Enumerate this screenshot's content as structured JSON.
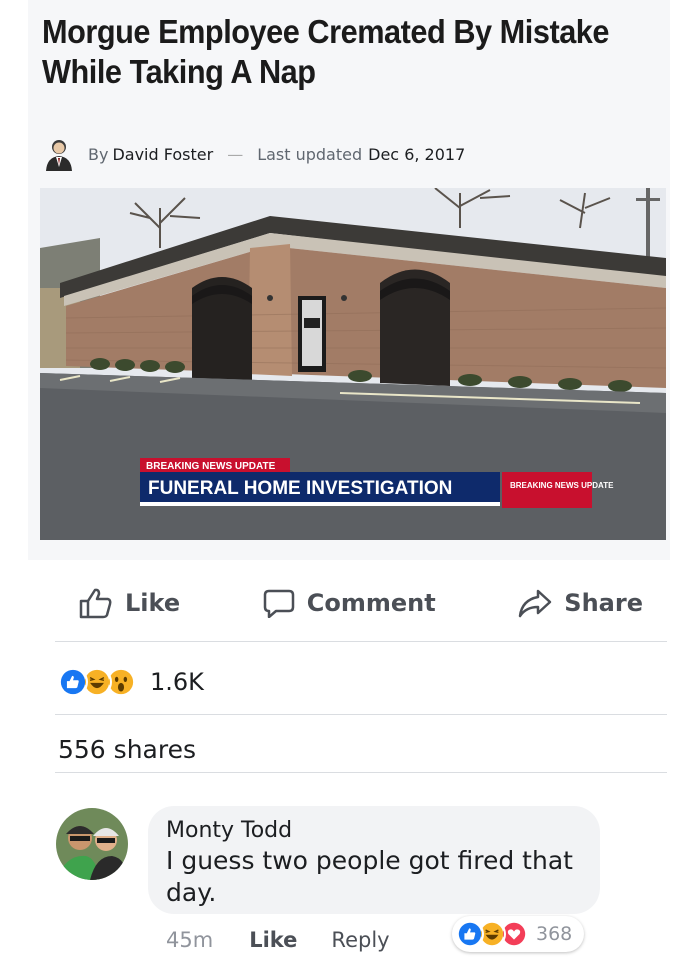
{
  "article": {
    "headline": "Morgue Employee Cremated By Mistake While Taking A Nap",
    "byline_prefix": "By",
    "author": "David Foster",
    "byline_separator": "—",
    "updated_label": "Last updated",
    "updated_date": "Dec 6, 2017",
    "photo_banner_top": "BREAKING NEWS UPDATE",
    "photo_banner_main": "FUNERAL HOME INVESTIGATION",
    "photo_banner_logo": "BREAKING NEWS UPDATE"
  },
  "actions": {
    "like_label": "Like",
    "comment_label": "Comment",
    "share_label": "Share"
  },
  "post_stats": {
    "reaction_icons": [
      "like-icon",
      "haha-icon",
      "wow-icon"
    ],
    "reaction_count": "1.6K",
    "shares": "556 shares"
  },
  "comment": {
    "author": "Monty Todd",
    "text": "I guess two people got fired that day.",
    "time": "45m",
    "like_label": "Like",
    "reply_label": "Reply",
    "reaction_icons": [
      "like-icon",
      "haha-icon",
      "love-icon"
    ],
    "reaction_count": "368"
  },
  "colors": {
    "like_blue": "#1877f2",
    "haha_yellow": "#f7b125",
    "love_red": "#f33e58",
    "news_red": "#c8102e"
  }
}
